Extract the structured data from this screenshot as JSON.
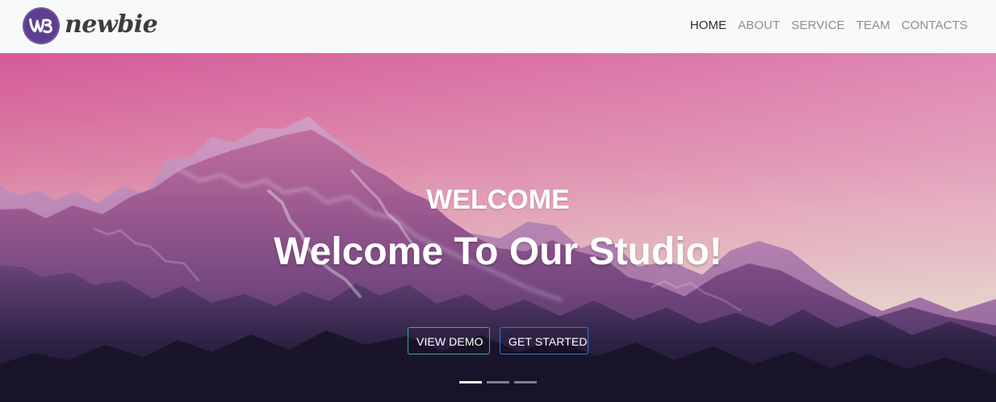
{
  "brand": {
    "badge_text": "W3",
    "name": "newbie",
    "badge_color": "#5e3f8f"
  },
  "nav": {
    "items": [
      {
        "label": "HOME",
        "active": true
      },
      {
        "label": "ABOUT",
        "active": false
      },
      {
        "label": "SERVICE",
        "active": false
      },
      {
        "label": "TEAM",
        "active": false
      },
      {
        "label": "CONTACTS",
        "active": false
      }
    ]
  },
  "hero": {
    "kicker": "WELCOME",
    "title": "Welcome To Our Studio!",
    "buttons": {
      "demo": "VIEW DEMO",
      "start": "GET STARTED"
    },
    "colors": {
      "sky_top": "#d45a98",
      "sky_bottom": "#f5e1d7",
      "demo_border": "#38b37f",
      "start_border": "#2f75d8"
    },
    "indicators": [
      {
        "active": true
      },
      {
        "active": false
      },
      {
        "active": false
      }
    ]
  }
}
